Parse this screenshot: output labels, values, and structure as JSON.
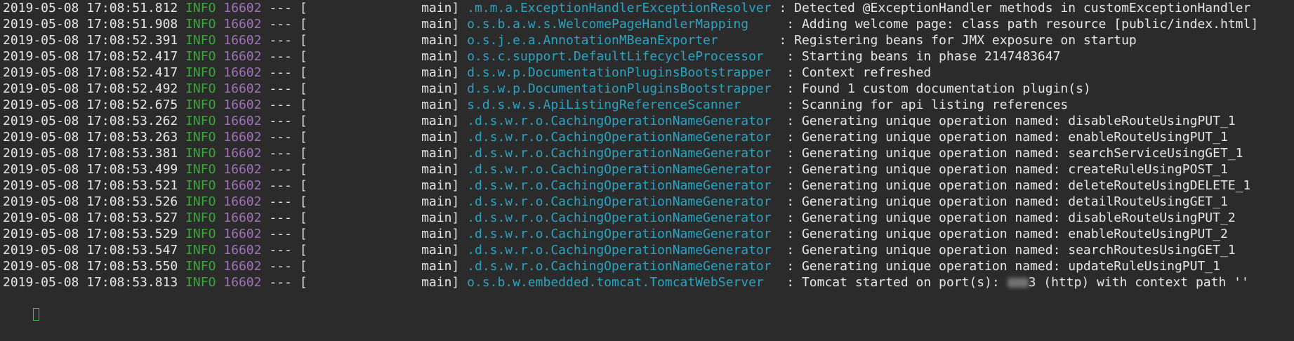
{
  "colors": {
    "background": "#2b2b2b",
    "text": "#e6e6e6",
    "level": "#3aa63a",
    "pid": "#a070b8",
    "logger": "#29a3c2",
    "cursor": "#3cc83c"
  },
  "lines": [
    {
      "ts": "2019-05-08 17:08:51.812",
      "level": "INFO",
      "pid": "16602",
      "sep": "---",
      "thread": "[               main]",
      "logger": ".m.m.a.ExceptionHandlerExceptionResolver",
      "msg": ": Detected @ExceptionHandler methods in customExceptionHandler"
    },
    {
      "ts": "2019-05-08 17:08:51.908",
      "level": "INFO",
      "pid": "16602",
      "sep": "---",
      "thread": "[               main]",
      "logger": "o.s.b.a.w.s.WelcomePageHandlerMapping    ",
      "msg": ": Adding welcome page: class path resource [public/index.html]"
    },
    {
      "ts": "2019-05-08 17:08:52.391",
      "level": "INFO",
      "pid": "16602",
      "sep": "---",
      "thread": "[               main]",
      "logger": "o.s.j.e.a.AnnotationMBeanExporter       ",
      "msg": ": Registering beans for JMX exposure on startup"
    },
    {
      "ts": "2019-05-08 17:08:52.417",
      "level": "INFO",
      "pid": "16602",
      "sep": "---",
      "thread": "[               main]",
      "logger": "o.s.c.support.DefaultLifecycleProcessor  ",
      "msg": ": Starting beans in phase 2147483647"
    },
    {
      "ts": "2019-05-08 17:08:52.417",
      "level": "INFO",
      "pid": "16602",
      "sep": "---",
      "thread": "[               main]",
      "logger": "d.s.w.p.DocumentationPluginsBootstrapper ",
      "msg": ": Context refreshed"
    },
    {
      "ts": "2019-05-08 17:08:52.492",
      "level": "INFO",
      "pid": "16602",
      "sep": "---",
      "thread": "[               main]",
      "logger": "d.s.w.p.DocumentationPluginsBootstrapper ",
      "msg": ": Found 1 custom documentation plugin(s)"
    },
    {
      "ts": "2019-05-08 17:08:52.675",
      "level": "INFO",
      "pid": "16602",
      "sep": "---",
      "thread": "[               main]",
      "logger": "s.d.s.w.s.ApiListingReferenceScanner     ",
      "msg": ": Scanning for api listing references"
    },
    {
      "ts": "2019-05-08 17:08:53.262",
      "level": "INFO",
      "pid": "16602",
      "sep": "---",
      "thread": "[               main]",
      "logger": ".d.s.w.r.o.CachingOperationNameGenerator ",
      "msg": ": Generating unique operation named: disableRouteUsingPUT_1"
    },
    {
      "ts": "2019-05-08 17:08:53.263",
      "level": "INFO",
      "pid": "16602",
      "sep": "---",
      "thread": "[               main]",
      "logger": ".d.s.w.r.o.CachingOperationNameGenerator ",
      "msg": ": Generating unique operation named: enableRouteUsingPUT_1"
    },
    {
      "ts": "2019-05-08 17:08:53.381",
      "level": "INFO",
      "pid": "16602",
      "sep": "---",
      "thread": "[               main]",
      "logger": ".d.s.w.r.o.CachingOperationNameGenerator ",
      "msg": ": Generating unique operation named: searchServiceUsingGET_1"
    },
    {
      "ts": "2019-05-08 17:08:53.499",
      "level": "INFO",
      "pid": "16602",
      "sep": "---",
      "thread": "[               main]",
      "logger": ".d.s.w.r.o.CachingOperationNameGenerator ",
      "msg": ": Generating unique operation named: createRuleUsingPOST_1"
    },
    {
      "ts": "2019-05-08 17:08:53.521",
      "level": "INFO",
      "pid": "16602",
      "sep": "---",
      "thread": "[               main]",
      "logger": ".d.s.w.r.o.CachingOperationNameGenerator ",
      "msg": ": Generating unique operation named: deleteRouteUsingDELETE_1"
    },
    {
      "ts": "2019-05-08 17:08:53.526",
      "level": "INFO",
      "pid": "16602",
      "sep": "---",
      "thread": "[               main]",
      "logger": ".d.s.w.r.o.CachingOperationNameGenerator ",
      "msg": ": Generating unique operation named: detailRouteUsingGET_1"
    },
    {
      "ts": "2019-05-08 17:08:53.527",
      "level": "INFO",
      "pid": "16602",
      "sep": "---",
      "thread": "[               main]",
      "logger": ".d.s.w.r.o.CachingOperationNameGenerator ",
      "msg": ": Generating unique operation named: disableRouteUsingPUT_2"
    },
    {
      "ts": "2019-05-08 17:08:53.529",
      "level": "INFO",
      "pid": "16602",
      "sep": "---",
      "thread": "[               main]",
      "logger": ".d.s.w.r.o.CachingOperationNameGenerator ",
      "msg": ": Generating unique operation named: enableRouteUsingPUT_2"
    },
    {
      "ts": "2019-05-08 17:08:53.547",
      "level": "INFO",
      "pid": "16602",
      "sep": "---",
      "thread": "[               main]",
      "logger": ".d.s.w.r.o.CachingOperationNameGenerator ",
      "msg": ": Generating unique operation named: searchRoutesUsingGET_1"
    },
    {
      "ts": "2019-05-08 17:08:53.550",
      "level": "INFO",
      "pid": "16602",
      "sep": "---",
      "thread": "[               main]",
      "logger": ".d.s.w.r.o.CachingOperationNameGenerator ",
      "msg": ": Generating unique operation named: updateRuleUsingPUT_1"
    },
    {
      "ts": "2019-05-08 17:08:53.813",
      "level": "INFO",
      "pid": "16602",
      "sep": "---",
      "thread": "[               main]",
      "logger": "o.s.b.w.embedded.tomcat.TomcatWebServer  ",
      "msg": ": Tomcat started on port(s): ",
      "msg_redacted_suffix": "3 (http) with context path ''"
    }
  ]
}
